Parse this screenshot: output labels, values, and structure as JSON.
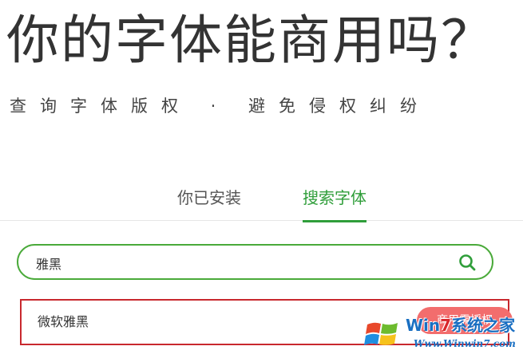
{
  "hero": {
    "title": "你的字体能商用吗？",
    "subtitle": "查询字体版权 · 避免侵权纠纷"
  },
  "tabs": [
    {
      "label": "你已安装",
      "active": false
    },
    {
      "label": "搜索字体",
      "active": true
    }
  ],
  "search": {
    "value": "雅黑",
    "icon": "search-icon"
  },
  "results": [
    {
      "name": "微软雅黑",
      "badge": "商用需授权"
    }
  ],
  "watermark": {
    "brand_prefix": "Win",
    "brand_digit": "7",
    "brand_suffix": "系统之家",
    "url": "Www.Winwin7.com"
  },
  "colors": {
    "accent": "#2f9e3a",
    "search_border": "#4aaa3a",
    "badge": "#f26d6d",
    "highlight_frame": "#c8282e"
  }
}
